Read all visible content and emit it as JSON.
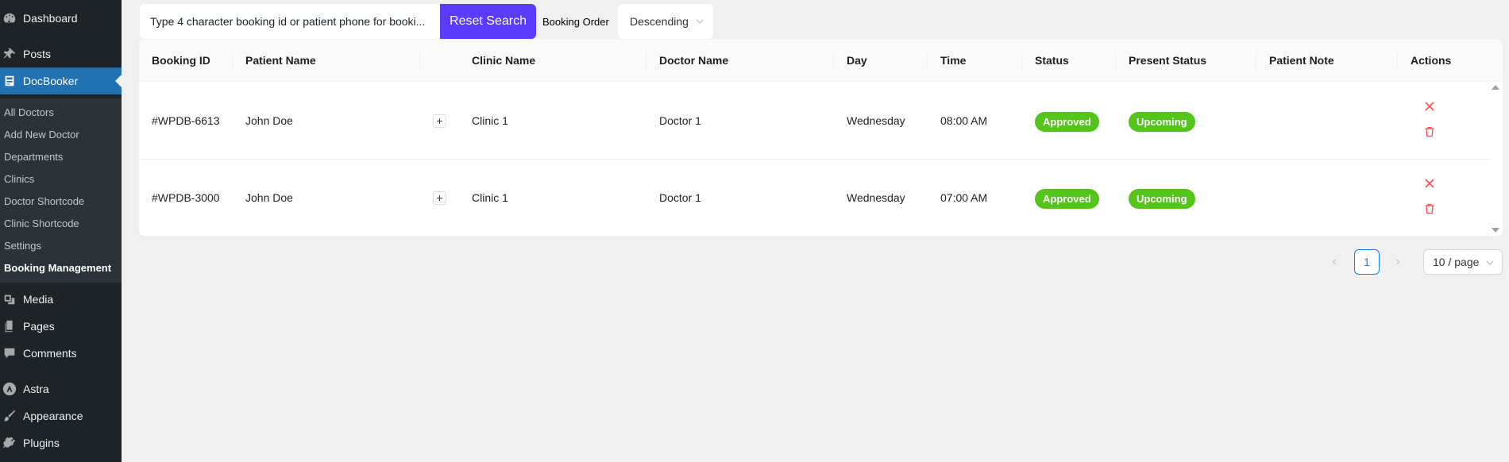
{
  "sidebar": {
    "menu": {
      "dashboard": "Dashboard",
      "posts": "Posts",
      "docbooker": "DocBooker",
      "media": "Media",
      "pages": "Pages",
      "comments": "Comments",
      "astra": "Astra",
      "appearance": "Appearance",
      "plugins": "Plugins"
    },
    "submenu": {
      "all_doctors": "All Doctors",
      "add_new_doctor": "Add New Doctor",
      "departments": "Departments",
      "clinics": "Clinics",
      "doctor_shortcode": "Doctor Shortcode",
      "clinic_shortcode": "Clinic Shortcode",
      "settings": "Settings",
      "booking_management": "Booking Management"
    }
  },
  "toolbar": {
    "search_placeholder": "Type 4 character booking id or patient phone for booki...",
    "reset_label": "Reset Search",
    "order_label": "Booking Order",
    "order_value": "Descending"
  },
  "table": {
    "headers": {
      "booking_id": "Booking ID",
      "patient_name": "Patient Name",
      "clinic_name": "Clinic Name",
      "doctor_name": "Doctor Name",
      "day": "Day",
      "time": "Time",
      "status": "Status",
      "present_status": "Present Status",
      "patient_note": "Patient Note",
      "actions": "Actions"
    },
    "rows": [
      {
        "booking_id": "#WPDB-6613",
        "patient_name": "John Doe",
        "expand": "+",
        "clinic_name": "Clinic 1",
        "doctor_name": "Doctor 1",
        "day": "Wednesday",
        "time": "08:00 AM",
        "status": "Approved",
        "present_status": "Upcoming",
        "patient_note": ""
      },
      {
        "booking_id": "#WPDB-3000",
        "patient_name": "John Doe",
        "expand": "+",
        "clinic_name": "Clinic 1",
        "doctor_name": "Doctor 1",
        "day": "Wednesday",
        "time": "07:00 AM",
        "status": "Approved",
        "present_status": "Upcoming",
        "patient_note": ""
      }
    ]
  },
  "pagination": {
    "prev": "‹",
    "current_page": "1",
    "next": "›",
    "page_size": "10 / page"
  },
  "colors": {
    "sidebar_bg": "#1d2327",
    "active_menu": "#2271b1",
    "reset_button": "#5b3cff",
    "status_tag": "#52c41a",
    "action_icon": "#ff4d4f",
    "pagination_accent": "#1677ff"
  }
}
